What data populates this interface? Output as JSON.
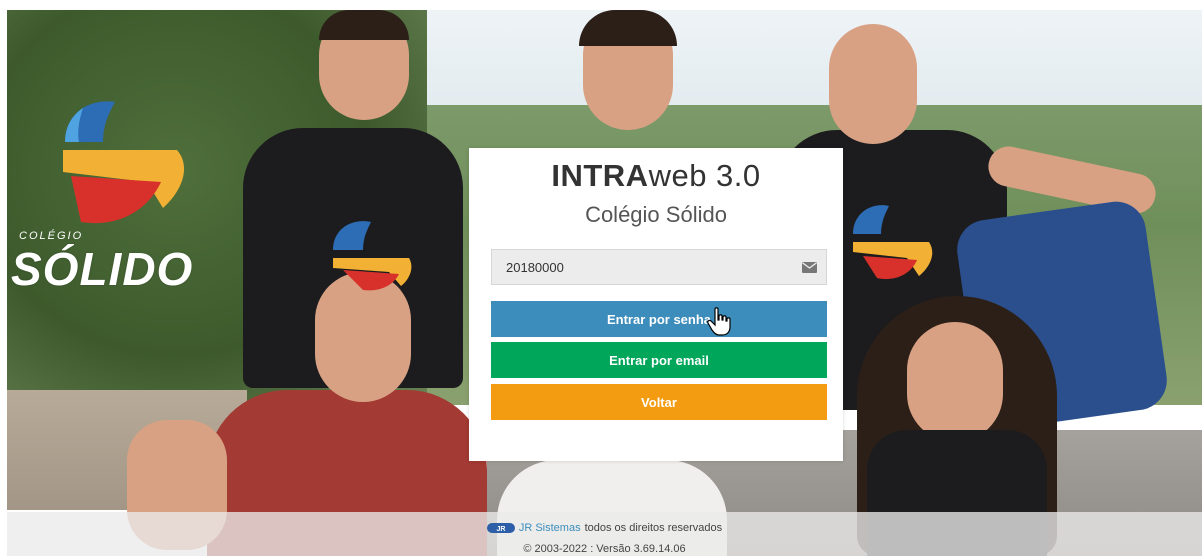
{
  "login": {
    "title_bold": "INTRA",
    "title_rest": "web 3.0",
    "subtitle": "Colégio Sólido",
    "user_field_value": "20180000",
    "user_field_icon": "envelope-icon",
    "buttons": {
      "senha": "Entrar por senha",
      "email": "Entrar por email",
      "voltar": "Voltar"
    }
  },
  "logo": {
    "small_text": "COLÉGIO",
    "big_text": "SÓLIDO"
  },
  "footer": {
    "company_link": "JR Sistemas",
    "rights_text": "todos os direitos reservados",
    "version_text": "© 2003-2022 : Versão 3.69.14.06"
  },
  "colors": {
    "primary": "#3c8dbc",
    "success": "#00a65a",
    "warning": "#f39c12"
  }
}
